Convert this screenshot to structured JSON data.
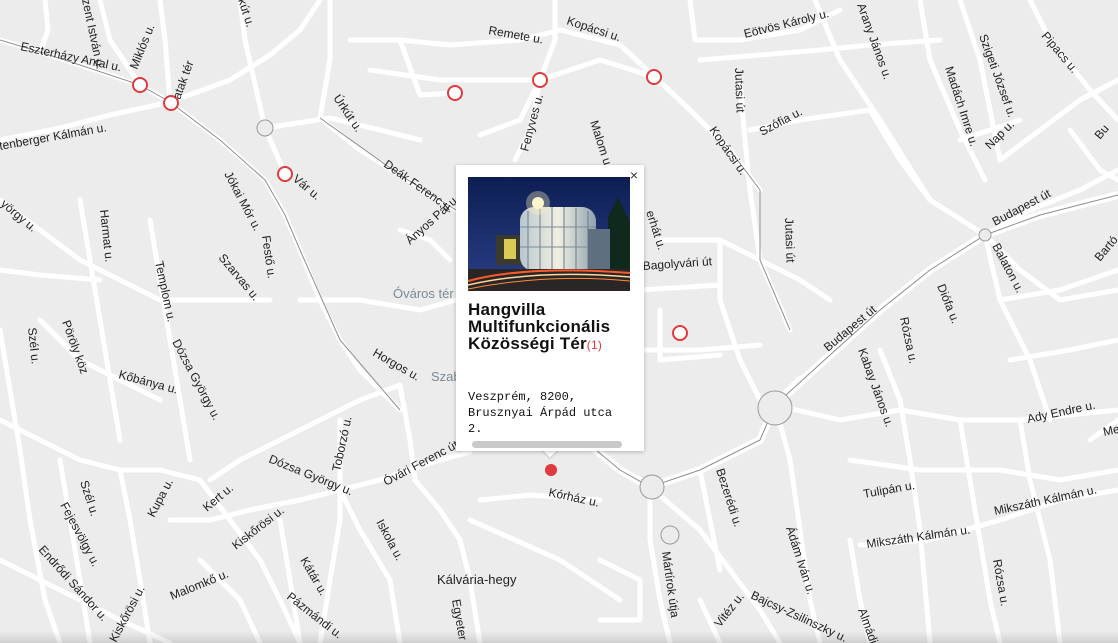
{
  "map": {
    "place_labels": {
      "ovaros": "Óváros tér",
      "szab": "Szab",
      "kalvaria": "Kálvária-hegy"
    },
    "street_labels": {
      "istvan": "zent István u.",
      "eszterhazy": "Eszterházy Antal u.",
      "miklos": "Miklós u.",
      "rak": "atak tér",
      "tenberger": "tenberger Kálmán u.",
      "kut": "kút u.",
      "remete": "Remete u.",
      "kopacsi1": "Kopácsi u.",
      "eotvos": "Eötvös Károly u.",
      "arany": "Arany János u.",
      "szigeti": "Szigeti József u.",
      "pipacs": "Pipacs u.",
      "urkut": "Úrkút u.",
      "fenyves": "Fenyves u.",
      "malom": "Malom u.",
      "jutasi1": "Jutasi út",
      "szofia": "Szófia u.",
      "kopacsi2": "Kopácsi u.",
      "madach": "Madách Imre u.",
      "nap": "Nap u.",
      "bu": "Bu",
      "var": "Vár u.",
      "jokai": "Jókai Mór u.",
      "deak": "Deák Ferenc u.",
      "anyos": "Ányos Pál u.",
      "ehat": "erhát u.",
      "bagolyvari": "Bagolyvári út",
      "jutasi2": "Jutasi út",
      "budapest1": "Budapest út",
      "barta": "Bartó",
      "balaton": "Balaton u.",
      "gyorgy": "yörgy u.",
      "harmat": "Harmat u.",
      "festo": "Festő u.",
      "szarvas": "Szarvas u.",
      "templom": "Templom u.",
      "diofa": "Diófa u.",
      "budapest2": "Budapest út",
      "rozsa1": "Rózsa u.",
      "szel1": "Szél u.",
      "porolykoz": "Pöröly köz",
      "dozsa1": "Dózsa György u.",
      "kobanya": "Kőbánya u.",
      "horgos": "Horgos u.",
      "kabay": "Kabay János u.",
      "ady": "Ady Endre u.",
      "me": "Me",
      "toborzo": "Toborzó u.",
      "ovari": "Óvári Ferenc út",
      "dozsa2": "Dózsa György u.",
      "korhaz": "Kórház u.",
      "bezeredi": "Bezerédi u.",
      "tulipan": "Tulipán u.",
      "mikszath1": "Mikszáth Kálmán u.",
      "mikszath2": "Mikszáth Kálmán u.",
      "szel2": "Szél u.",
      "kupa": "Kupa u.",
      "kert": "Kert u.",
      "fejesvolgy": "Fejesvölgy u.",
      "kiskorosi1": "Kiskőrösi u.",
      "iskola": "Iskola u.",
      "endrodi": "Endrődi Sándor u.",
      "katar": "Kátár u.",
      "martirok": "Mártírok útja",
      "adam": "Ádám Iván u.",
      "rozsa2": "Rózsa u.",
      "vitez": "Vitéz u.",
      "bajcsy": "Bajcsy-Zsilinszky u.",
      "almad": "Almádi",
      "kiskorosi2": "Kiskőrösi u.",
      "malomko": "Malomkő u.",
      "pazmandi": "Pázmándi u.",
      "egyeter": "Egyeter"
    }
  },
  "popup": {
    "close_label": "×",
    "title": "Hangvilla Multifunkcionális Közösségi Tér",
    "count": "(1)",
    "address_line1": "Veszprém, 8200,",
    "address_line2": "Brusznyai Árpád utca",
    "address_line3": "2."
  }
}
